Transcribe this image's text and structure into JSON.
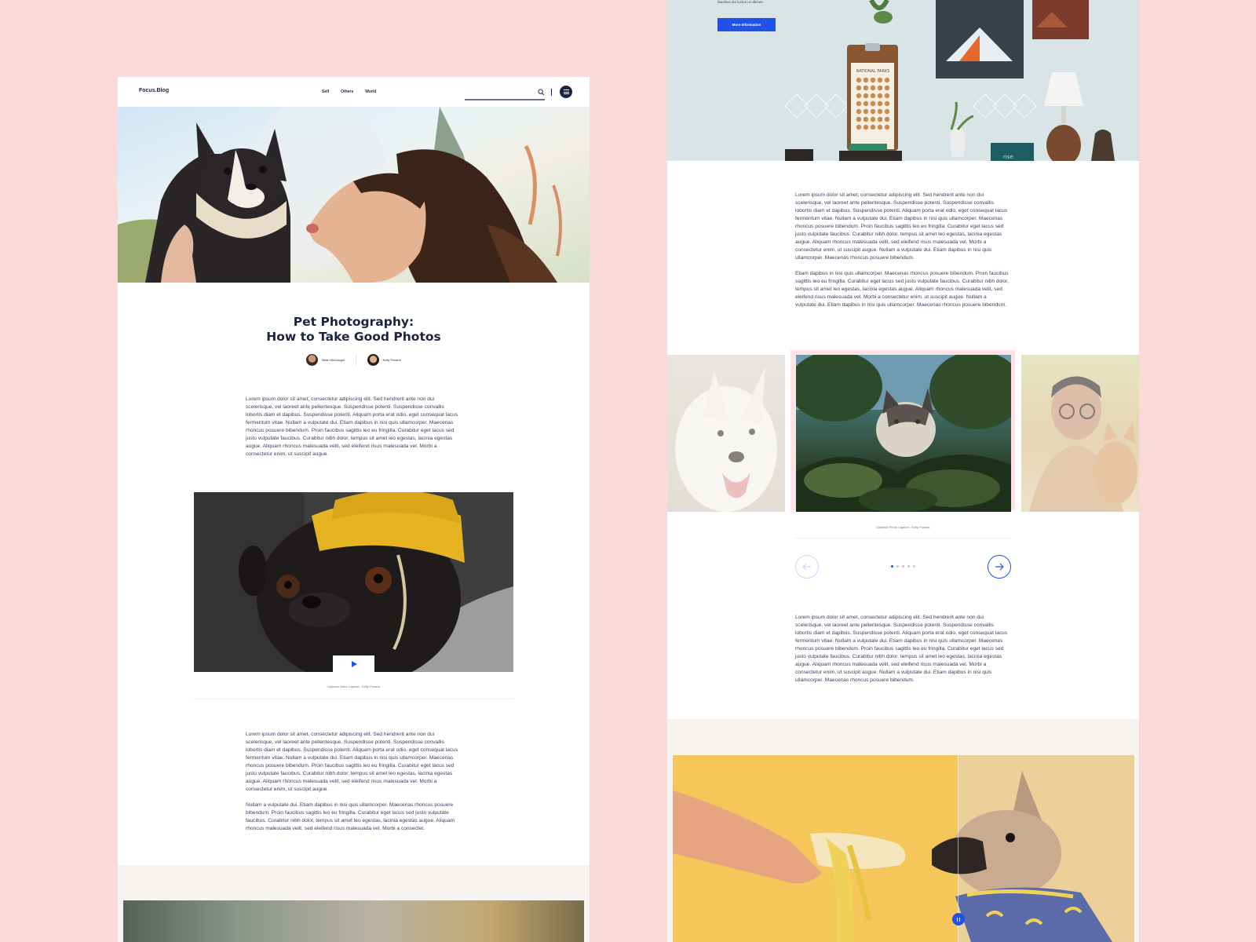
{
  "left_page": {
    "nav": {
      "logo": "Focus.Blog",
      "links": [
        "Self",
        "Others",
        "World"
      ]
    },
    "article": {
      "title_line1": "Pet Photography:",
      "title_line2": "How to Take Good Photos",
      "authors": [
        {
          "name": "Brian McDougal"
        },
        {
          "name": "Kelly Powers"
        }
      ],
      "paragraph1": "Lorem ipsum dolor sit amet, consectetur adipiscing elit. Sed hendrerit ante non dui scelerisque, vel laoreet ante pellentesque. Suspendisse potenti. Suspendisse convallis lobortis diam et dapibus. Suspendisse potenti. Aliquam porta erat odio, eget consequat lacus fermentum vitae. Nullam a vulputate dui. Etiam dapibus in nisi quis ullamcorper. Maecenas rhoncus posuere bibendum. Proin faucibus sagittis leo eu fringilla. Curabitur eget lacus sed justo vulputate faucibus. Curabitur nibh dolor, tempus sit amet leo egestas, lacinia egestas augue. Aliquam rhoncus malesuada velit, sed eleifend risus malesuada vel. Morbi a consectetur enim, ut suscipit augue.",
      "video_caption": "Optional Video Caption - Kelly Powers",
      "paragraph2": "Lorem ipsum dolor sit amet, consectetur adipiscing elit. Sed hendrerit ante non dui scelerisque, vel laoreet ante pellentesque. Suspendisse potenti. Suspendisse convallis lobortis diam et dapibus. Suspendisse potenti. Aliquam porta erat odio, eget consequat lacus fermentum vitae. Nullam a vulputate dui. Etiam dapibus in nisi quis ullamcorper. Maecenas rhoncus posuere bibendum. Proin faucibus sagittis leo eu fringilla. Curabitur eget lacus sed justo vulputate faucibus. Curabitur nibh dolor, tempus sit amet leo egestas, lacinia egestas augue. Aliquam rhoncus malesuada velit, sed eleifend risus malesuada vel. Morbi a consectetur enim, ut suscipit augue.",
      "paragraph3": "Nullam a vulputate dui. Etiam dapibus in nisi quis ullamcorper. Maecenas rhoncus posuere bibendum. Proin faucibus sagittis leo eu fringilla. Curabitur eget lacus sed justo vulputate faucibus. Curabitur nibh dolor, tempus sit amet leo egestas, lacinia egestas augue. Aliquam rhoncus malesuada velit, sed eleifend risus malesuada vel. Morbi a consectet."
    }
  },
  "right_page": {
    "hero": {
      "text": "faucibus dui luctus ut ultrices.",
      "button_label": "More Information",
      "poster_label": "NATIONAL PARKS",
      "book_label": "rise"
    },
    "paragraph1": "Lorem ipsum dolor sit amet, consectetur adipiscing elit. Sed hendrerit ante non dui scelerisque, vel laoreet ante pellentesque. Suspendisse potenti. Suspendisse convallis lobortis diam et dapibus. Suspendisse potenti. Aliquam porta erat odio, eget consequat lacus fermentum vitae. Nullam a vulputate dui. Etiam dapibus in nisi quis ullamcorper. Maecenas rhoncus posuere bibendum. Proin faucibus sagittis leo eu fringilla. Curabitur eget lacus sed justo vulputate faucibus. Curabitur nibh dolor, tempus sit amet leo egestas, lacinia egestas augue. Aliquam rhoncus malesuada velit, sed eleifend risus malesuada vel. Morbi a consectetur enim, ut suscipit augue. Nullam a vulputate dui. Etiam dapibus in nisi quis ullamcorper. Maecenas rhoncus posuere bibendum.",
    "paragraph2": "Etiam dapibus in nisi quis ullamcorper. Maecenas rhoncus posuere bibendum. Proin faucibus sagittis leo eu fringilla. Curabitur eget lacus sed justo vulputate faucibus. Curabitur nibh dolor, tempus sit amet leo egestas, lacinia egestas augue. Aliquam rhoncus malesuada velit, sed eleifend risus malesuada vel. Morbi a consectetur enim, ut suscipit augue. Nullam a vulputate dui. Etiam dapibus in nisi quis ullamcorper. Maecenas rhoncus posuere bibendum.",
    "carousel": {
      "caption": "Optional Photo Caption - Kelly Powers",
      "slide_count": 5,
      "active_index": 0
    },
    "paragraph3": "Lorem ipsum dolor sit amet, consectetur adipiscing elit. Sed hendrerit ante non dui scelerisque, vel laoreet ante pellentesque. Suspendisse potenti. Suspendisse convallis lobortis diam et dapibus. Suspendisse potenti. Aliquam porta erat odio, eget consequat lacus fermentum vitae. Nullam a vulputate dui. Etiam dapibus in nisi quis ullamcorper. Maecenas rhoncus posuere bibendum. Proin faucibus sagittis leo eu fringilla. Curabitur eget lacus sed justo vulputate faucibus. Curabitur nibh dolor, tempus sit amet leo egestas, lacinia egestas augue. Aliquam rhoncus malesuada velit, sed eleifend risus malesuada vel. Morbi a consectetur enim, ut suscipit augue. Nullam a vulputate dui. Etiam dapibus in nisi quis ullamcorper. Maecenas rhoncus posuere bibendum."
  },
  "colors": {
    "background": "#fcd9d9",
    "accent_blue": "#2152e8",
    "text_navy": "#1c2340"
  },
  "icons": [
    "search-icon",
    "menu-icon",
    "play-icon",
    "arrow-left-icon",
    "arrow-right-icon",
    "compare-handle-icon"
  ]
}
